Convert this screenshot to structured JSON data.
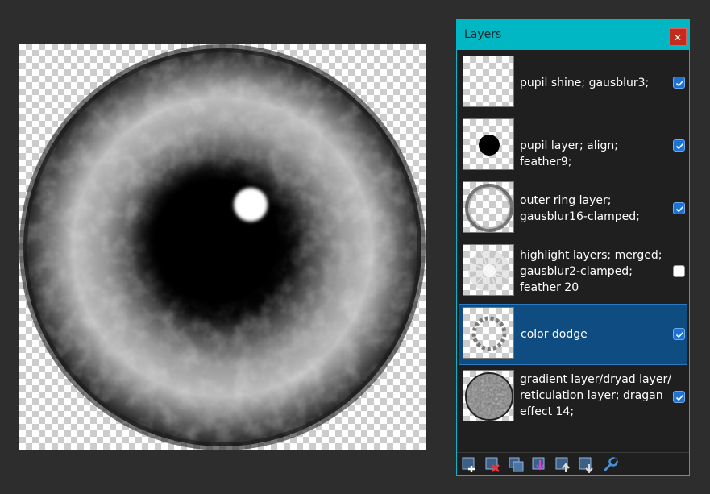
{
  "panel": {
    "title": "Layers",
    "close_glyph": "✕"
  },
  "layers": [
    {
      "name": "pupil shine; gausblur3;",
      "visible": true,
      "selected": false,
      "thumb_icon": "empty-transparent-thumb"
    },
    {
      "name": "pupil layer; align; feather9;",
      "visible": true,
      "selected": false,
      "thumb_icon": "black-dot-thumb"
    },
    {
      "name": "outer ring layer; gausblur16-clamped;",
      "visible": true,
      "selected": false,
      "thumb_icon": "ring-thumb"
    },
    {
      "name": "highlight layers; merged; gausblur2-clamped; feather 20",
      "visible": false,
      "selected": false,
      "thumb_icon": "starburst-thumb"
    },
    {
      "name": "color dodge",
      "visible": true,
      "selected": true,
      "thumb_icon": "dotted-ring-thumb"
    },
    {
      "name": "gradient layer/dryad layer/ reticulation layer; dragan effect 14;",
      "visible": true,
      "selected": false,
      "thumb_icon": "textured-disc-thumb"
    }
  ],
  "toolbar": {
    "buttons": [
      "add-layer-icon",
      "delete-layer-icon",
      "duplicate-layer-icon",
      "merge-layer-down-icon",
      "move-layer-up-icon",
      "move-layer-down-icon",
      "layer-properties-wrench-icon"
    ]
  },
  "colors": {
    "app_background": "#2d2d2d",
    "titlebar_accent": "#00b7c3",
    "close_button": "#c42b1c",
    "selection": "#0f4c81",
    "checkbox_checked": "#1a73d9"
  }
}
